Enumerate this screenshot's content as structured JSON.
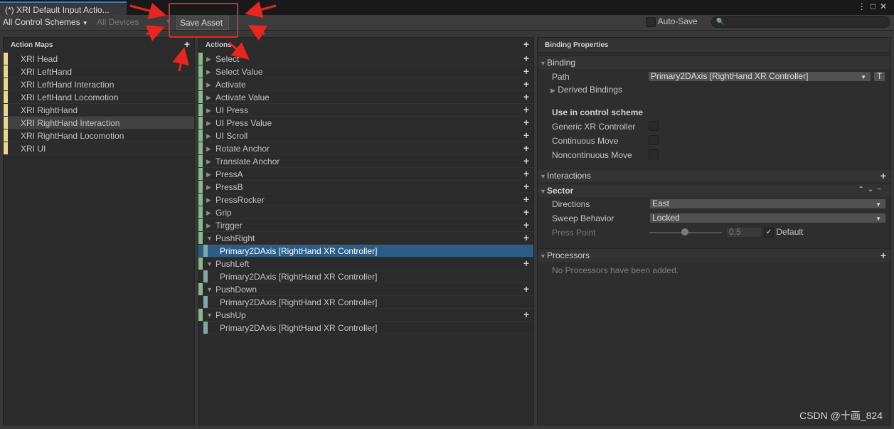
{
  "window": {
    "tab_title": "(*) XRI Default Input Actio..."
  },
  "toolbar": {
    "control_schemes": "All Control Schemes",
    "devices": "All Devices",
    "save_asset": "Save Asset",
    "auto_save": "Auto-Save"
  },
  "action_maps": {
    "header": "Action Maps",
    "items": [
      "XRI Head",
      "XRI LeftHand",
      "XRI LeftHand Interaction",
      "XRI LeftHand Locomotion",
      "XRI RightHand",
      "XRI RightHand Interaction",
      "XRI RightHand Locomotion",
      "XRI UI"
    ],
    "selected": "XRI RightHand Interaction"
  },
  "actions": {
    "header": "Actions",
    "items": [
      "Select",
      "Select Value",
      "Activate",
      "Activate Value",
      "UI Press",
      "UI Press Value",
      "UI Scroll",
      "Rotate Anchor",
      "Translate Anchor",
      "PressA",
      "PressB",
      "PressRocker",
      "Grip",
      "Tirgger",
      "PushRight",
      "Primary2DAxis [RightHand XR Controller]",
      "PushLeft",
      "Primary2DAxis [RightHand XR Controller]",
      "PushDown",
      "Primary2DAxis [RightHand XR Controller]",
      "PushUp",
      "Primary2DAxis [RightHand XR Controller]"
    ]
  },
  "binding_properties": {
    "header": "Binding Properties",
    "binding": {
      "title": "Binding",
      "path_label": "Path",
      "path_value": "Primary2DAxis [RightHand XR Controller]",
      "t_button": "T",
      "derived": "Derived Bindings"
    },
    "schemes": {
      "title": "Use in control scheme",
      "items": [
        "Generic XR Controller",
        "Continuous Move",
        "Noncontinuous Move"
      ]
    },
    "interactions": {
      "title": "Interactions"
    },
    "sector": {
      "title": "Sector",
      "directions_label": "Directions",
      "directions_value": "East",
      "sweep_label": "Sweep Behavior",
      "sweep_value": "Locked",
      "press_label": "Press Point",
      "press_value": "0.5",
      "default_label": "Default"
    },
    "processors": {
      "title": "Processors",
      "empty": "No Processors have been added."
    }
  },
  "watermark": "CSDN @十画_824"
}
